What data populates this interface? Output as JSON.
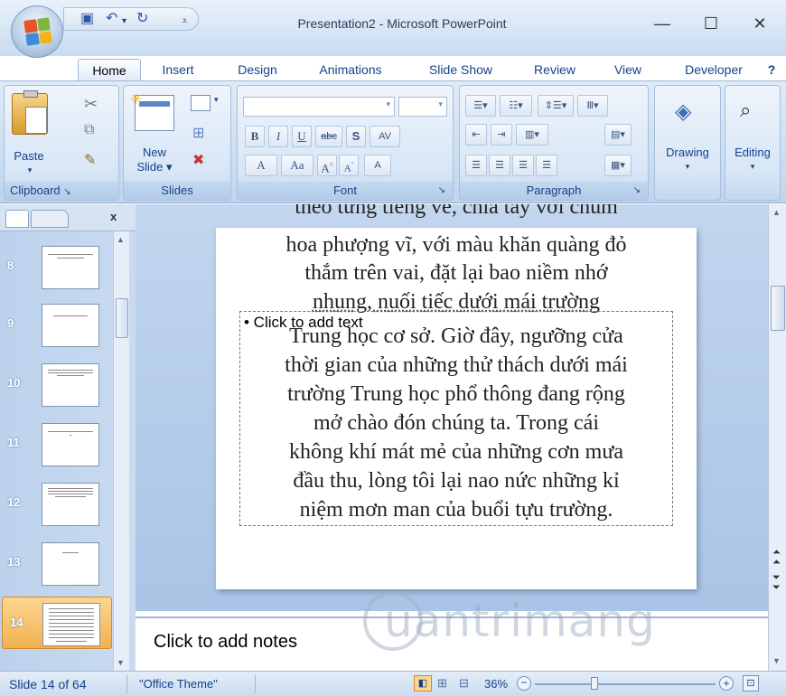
{
  "window": {
    "title": "Presentation2 - Microsoft PowerPoint",
    "minimize": "—",
    "maximize": "☐",
    "close": "✕"
  },
  "tabs": [
    "Home",
    "Insert",
    "Design",
    "Animations",
    "Slide Show",
    "Review",
    "View",
    "Developer"
  ],
  "ribbon": {
    "clipboard": {
      "label": "Clipboard",
      "paste": "Paste"
    },
    "slides": {
      "label": "Slides",
      "new_slide_line1": "New",
      "new_slide_line2": "Slide ▾"
    },
    "font": {
      "label": "Font",
      "bold": "B",
      "italic": "I",
      "underline": "U",
      "strike": "abc",
      "shadow": "S",
      "spacing": "AV",
      "grow": "A",
      "aa": "Aa",
      "clear": "A"
    },
    "paragraph": {
      "label": "Paragraph"
    },
    "drawing": "Drawing",
    "editing": "Editing"
  },
  "thumbnails": [
    {
      "num": "8"
    },
    {
      "num": "9"
    },
    {
      "num": "10"
    },
    {
      "num": "11"
    },
    {
      "num": "12"
    },
    {
      "num": "13"
    },
    {
      "num": "14"
    }
  ],
  "slide": {
    "lines_top": [
      "theo từng tiếng ve, chia tay với chùm",
      "hoa phượng vĩ, với màu khăn quàng đỏ",
      "thắm trên vai, đặt lại bao niềm nhớ",
      "nhung, nuối tiếc dưới mái trường"
    ],
    "placeholder_hint": "• Click to add text",
    "lines_body": [
      "Trung học cơ sở. Giờ đây, ngưỡng cửa",
      "thời gian của những thử thách dưới mái",
      "trường Trung học phổ thông đang rộng",
      "mở chào đón chúng ta. Trong cái",
      "không khí mát mẻ của những cơn mưa",
      "đầu thu, lòng tôi lại nao nức những kỉ",
      "niệm mơn man của buổi tựu trường."
    ]
  },
  "notes": "Click to add notes",
  "status": {
    "slide": "Slide 14 of 64",
    "theme": "\"Office Theme\"",
    "zoom": "36%"
  },
  "watermark": "uantrimang",
  "colors": {
    "ribbon_bg": "#c9dcf0",
    "accent": "#15428b",
    "selected_thumb": "#f6b45a"
  }
}
